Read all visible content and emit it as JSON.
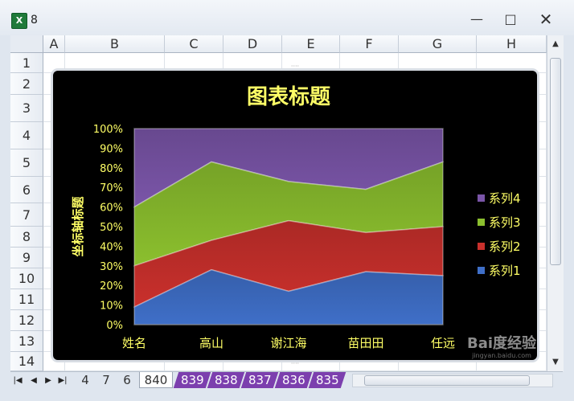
{
  "window": {
    "title": "8",
    "app_icon": "excel-icon",
    "controls": [
      "minimize-icon",
      "restore-icon",
      "close-icon"
    ]
  },
  "sheet": {
    "columns": [
      "A",
      "B",
      "C",
      "D",
      "E",
      "F",
      "G",
      "H"
    ],
    "rows": [
      "1",
      "2",
      "3",
      "4",
      "5",
      "6",
      "7",
      "8",
      "9",
      "10",
      "11",
      "12",
      "13",
      "14"
    ]
  },
  "tabs": [
    {
      "label": "4",
      "style": "plain"
    },
    {
      "label": "7",
      "style": "plain"
    },
    {
      "label": "6",
      "style": "plain"
    },
    {
      "label": "840",
      "style": "active"
    },
    {
      "label": "839",
      "style": "purple"
    },
    {
      "label": "838",
      "style": "purple"
    },
    {
      "label": "837",
      "style": "purple"
    },
    {
      "label": "836",
      "style": "purple"
    },
    {
      "label": "835",
      "style": "purple"
    }
  ],
  "colors": {
    "chart_bg": "#000000",
    "title_color": "#ffff66",
    "axis_text": "#ffff66",
    "series1": "#3f6fc8",
    "series2": "#c9302c",
    "series3": "#8bbf2e",
    "series4": "#7a55a8",
    "tab_purple": "#7c3fae"
  },
  "chart_data": {
    "type": "area",
    "stacked": "percent",
    "title": "图表标题",
    "xlabel": "",
    "ylabel": "坐标轴标题",
    "categories": [
      "姓名",
      "高山",
      "谢江海",
      "苗田田",
      "任远"
    ],
    "yticks": [
      "0%",
      "10%",
      "20%",
      "30%",
      "40%",
      "50%",
      "60%",
      "70%",
      "80%",
      "90%",
      "100%"
    ],
    "ylim": [
      0,
      100
    ],
    "legend_position": "right",
    "series": [
      {
        "name": "系列1",
        "values": [
          9,
          28,
          17,
          27,
          25
        ]
      },
      {
        "name": "系列2",
        "values": [
          21,
          15,
          36,
          20,
          25
        ]
      },
      {
        "name": "系列3",
        "values": [
          30,
          40,
          20,
          22,
          33
        ]
      },
      {
        "name": "系列4",
        "values": [
          40,
          17,
          27,
          31,
          17
        ]
      }
    ],
    "legend": [
      "系列4",
      "系列3",
      "系列2",
      "系列1"
    ]
  },
  "watermark": {
    "brand": "Bai度经验",
    "url": "jingyan.baidu.com"
  }
}
